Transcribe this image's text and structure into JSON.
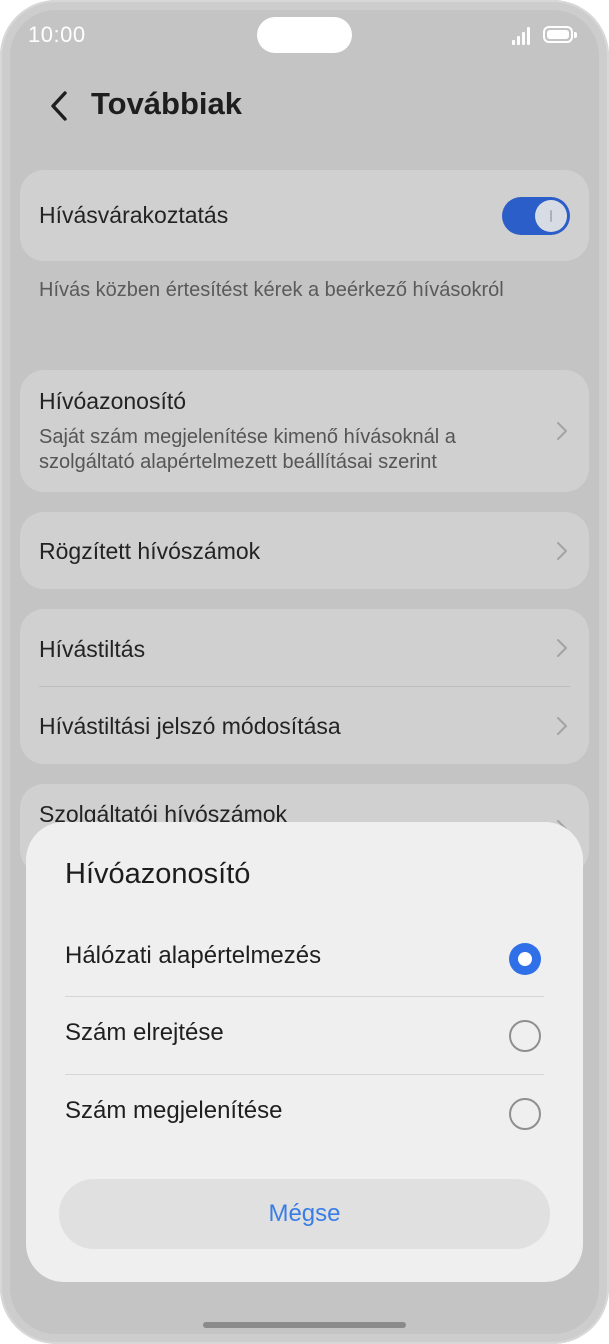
{
  "status_bar": {
    "time": "10:00"
  },
  "header": {
    "title": "Továbbiak"
  },
  "settings": {
    "call_waiting": {
      "label": "Hívásvárakoztatás",
      "enabled": true,
      "description": "Hívás közben értesítést kérek a beérkező hívásokról"
    },
    "caller_id": {
      "label": "Hívóazonosító",
      "subtitle": "Saját szám megjelenítése kimenő hívásoknál a szolgáltató alapértelmezett beállításai szerint"
    },
    "fixed_dialing": {
      "label": "Rögzített hívószámok"
    },
    "call_barring": {
      "label": "Hívástiltás"
    },
    "call_barring_password": {
      "label": "Hívástiltási jelszó módosítása"
    },
    "service_numbers": {
      "label": "Szolgáltatói hívószámok"
    }
  },
  "dialog": {
    "title": "Hívóazonosító",
    "options": [
      {
        "label": "Hálózati alapértelmezés",
        "selected": true
      },
      {
        "label": "Szám elrejtése",
        "selected": false
      },
      {
        "label": "Szám megjelenítése",
        "selected": false
      }
    ],
    "cancel_label": "Mégse"
  },
  "colors": {
    "accent": "#2f6fe8",
    "toggle_on": "#2b5ec8",
    "cancel_text": "#3a7de6"
  },
  "icons": {
    "back": "chevron-left-icon",
    "row_arrow": "chevron-right-icon"
  }
}
